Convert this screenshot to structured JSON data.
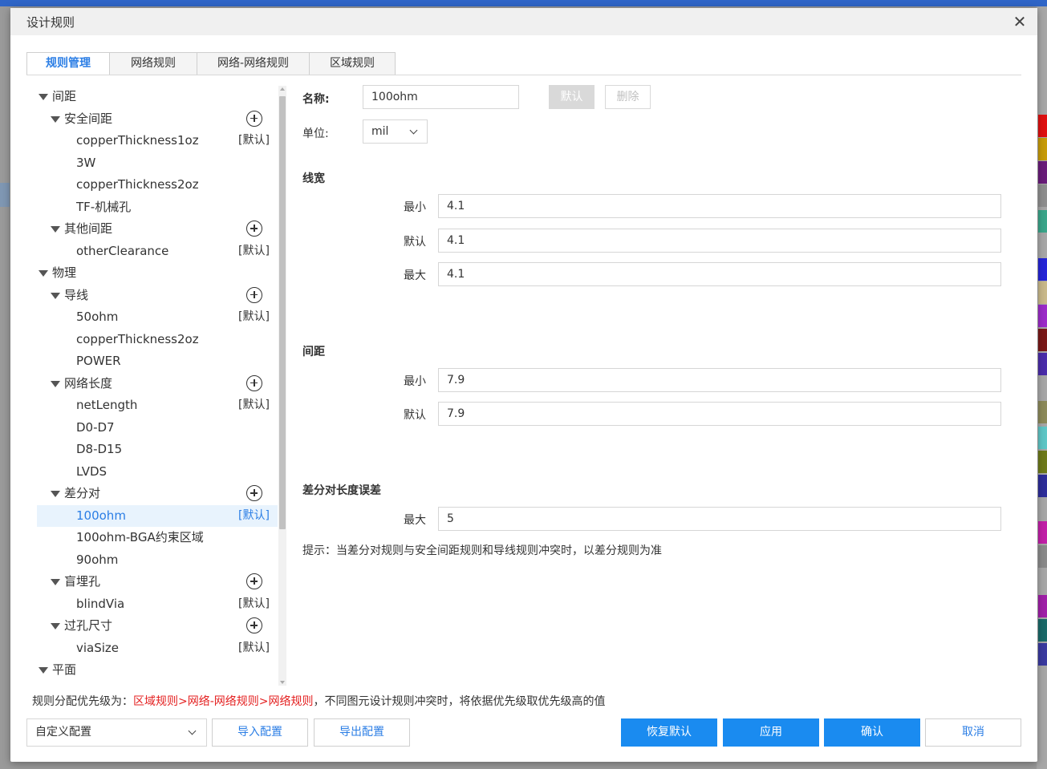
{
  "dialog": {
    "title": "设计规则"
  },
  "tabs": [
    {
      "label": "规则管理",
      "active": true
    },
    {
      "label": "网络规则",
      "active": false
    },
    {
      "label": "网络-网络规则",
      "active": false
    },
    {
      "label": "区域规则",
      "active": false
    }
  ],
  "tree": {
    "default_tag": "[默认]",
    "items": [
      {
        "label": "间距",
        "level": 0
      },
      {
        "label": "安全间距",
        "level": 1,
        "add": true
      },
      {
        "label": "copperThickness1oz",
        "level": 2,
        "default": true
      },
      {
        "label": "3W",
        "level": 2
      },
      {
        "label": "copperThickness2oz",
        "level": 2
      },
      {
        "label": "TF-机械孔",
        "level": 2
      },
      {
        "label": "其他间距",
        "level": 1,
        "add": true
      },
      {
        "label": "otherClearance",
        "level": 2,
        "default": true
      },
      {
        "label": "物理",
        "level": 0
      },
      {
        "label": "导线",
        "level": 1,
        "add": true
      },
      {
        "label": "50ohm",
        "level": 2,
        "default": true
      },
      {
        "label": "copperThickness2oz",
        "level": 2
      },
      {
        "label": "POWER",
        "level": 2
      },
      {
        "label": "网络长度",
        "level": 1,
        "add": true
      },
      {
        "label": "netLength",
        "level": 2,
        "default": true
      },
      {
        "label": "D0-D7",
        "level": 2
      },
      {
        "label": "D8-D15",
        "level": 2
      },
      {
        "label": "LVDS",
        "level": 2
      },
      {
        "label": "差分对",
        "level": 1,
        "add": true
      },
      {
        "label": "100ohm",
        "level": 2,
        "default": true,
        "selected": true
      },
      {
        "label": "100ohm-BGA约束区域",
        "level": 2
      },
      {
        "label": "90ohm",
        "level": 2
      },
      {
        "label": "盲埋孔",
        "level": 1,
        "add": true
      },
      {
        "label": "blindVia",
        "level": 2,
        "default": true
      },
      {
        "label": "过孔尺寸",
        "level": 1,
        "add": true
      },
      {
        "label": "viaSize",
        "level": 2,
        "default": true
      },
      {
        "label": "平面",
        "level": 0
      }
    ]
  },
  "form": {
    "name_label": "名称:",
    "name_value": "100ohm",
    "default_button": "默认",
    "delete_button": "删除",
    "unit_label": "单位:",
    "unit_value": "mil",
    "line_width": {
      "title": "线宽",
      "min_label": "最小",
      "min_value": "4.1",
      "default_label": "默认",
      "default_value": "4.1",
      "max_label": "最大",
      "max_value": "4.1"
    },
    "spacing": {
      "title": "间距",
      "min_label": "最小",
      "min_value": "7.9",
      "default_label": "默认",
      "default_value": "7.9"
    },
    "diff_length": {
      "title": "差分对长度误差",
      "max_label": "最大",
      "max_value": "5"
    },
    "hint": "提示：当差分对规则与安全间距规则和导线规则冲突时，以差分规则为准"
  },
  "priority": {
    "prefix": "规则分配优先级为：",
    "order": "区域规则>网络-网络规则>网络规则",
    "suffix": "，不同图元设计规则冲突时，将依据优先级取优先级高的值"
  },
  "footer": {
    "config_select": "自定义配置",
    "import_button": "导入配置",
    "export_button": "导出配置",
    "restore_button": "恢复默认",
    "apply_button": "应用",
    "confirm_button": "确认",
    "cancel_button": "取消"
  },
  "colors": {
    "accent": "#2b7ee5",
    "primary_button": "#1a8bf0",
    "selected_row": "#e8f3fd",
    "priority_red": "#e42121",
    "disabled_button": "#d9d9d9"
  }
}
